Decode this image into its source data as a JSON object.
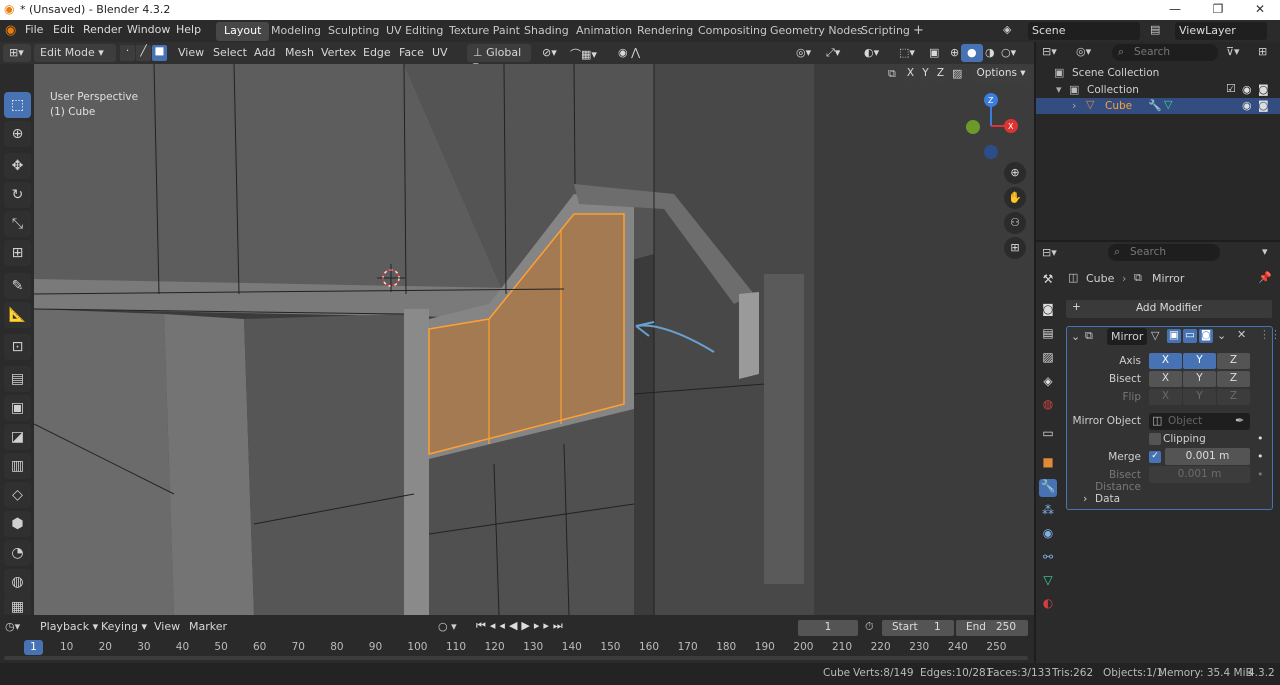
{
  "window": {
    "title": "* (Unsaved) - Blender 4.3.2",
    "minimize": "—",
    "maximize": "❐",
    "close": "✕"
  },
  "menu": [
    "File",
    "Edit",
    "Render",
    "Window",
    "Help"
  ],
  "workspaces": [
    "Layout",
    "Modeling",
    "Sculpting",
    "UV Editing",
    "Texture Paint",
    "Shading",
    "Animation",
    "Rendering",
    "Compositing",
    "Geometry Nodes",
    "Scripting",
    "+"
  ],
  "scene": {
    "name": "Scene",
    "viewlayer": "ViewLayer"
  },
  "viewport_header": {
    "mode": "Edit Mode",
    "menus": [
      "View",
      "Select",
      "Add",
      "Mesh",
      "Vertex",
      "Edge",
      "Face",
      "UV"
    ],
    "orientation": "Global",
    "options": "Options",
    "axes": [
      "X",
      "Y",
      "Z"
    ]
  },
  "viewport_overlay": {
    "perspective": "User Perspective",
    "object": "(1) Cube"
  },
  "gizmo": {
    "z": "Z",
    "x": "X"
  },
  "outliner": {
    "search_placeholder": "Search",
    "root": "Scene Collection",
    "collection": "Collection",
    "object": "Cube"
  },
  "properties": {
    "search_placeholder": "Search",
    "breadcrumb_object": "Cube",
    "breadcrumb_modifier": "Mirror",
    "add_modifier": "Add Modifier",
    "modifier_name": "Mirror",
    "axis_label": "Axis",
    "bisect_label": "Bisect",
    "flip_label": "Flip",
    "axis_buttons": [
      "X",
      "Y",
      "Z"
    ],
    "mirror_object_label": "Mirror Object",
    "mirror_object_placeholder": "Object",
    "clipping_label": "Clipping",
    "merge_label": "Merge",
    "merge_value": "0.001 m",
    "bisect_distance_label": "Bisect Distance",
    "bisect_distance_value": "0.001 m",
    "data_label": "Data",
    "axis_state": [
      true,
      true,
      false
    ],
    "merge_checked": true,
    "clipping_checked": false
  },
  "timeline": {
    "menus": [
      "Playback",
      "Keying",
      "View",
      "Marker"
    ],
    "current_frame": "1",
    "start_label": "Start",
    "start": "1",
    "end_label": "End",
    "end": "250",
    "ticks": [
      "1",
      "10",
      "20",
      "30",
      "40",
      "50",
      "60",
      "70",
      "80",
      "90",
      "100",
      "110",
      "120",
      "130",
      "140",
      "150",
      "160",
      "170",
      "180",
      "190",
      "200",
      "210",
      "220",
      "230",
      "240",
      "250"
    ]
  },
  "status": {
    "object": "Cube",
    "verts": "Verts:8/149",
    "edges": "Edges:10/281",
    "faces": "Faces:3/133",
    "tris": "Tris:262",
    "objects": "Objects:1/1",
    "memory": "Memory: 35.4 MiB",
    "version": "4.3.2"
  },
  "colors": {
    "accent": "#4772b3",
    "selected_face": "#a47a52",
    "selected_edge": "#ffa033",
    "header": "#303030"
  }
}
